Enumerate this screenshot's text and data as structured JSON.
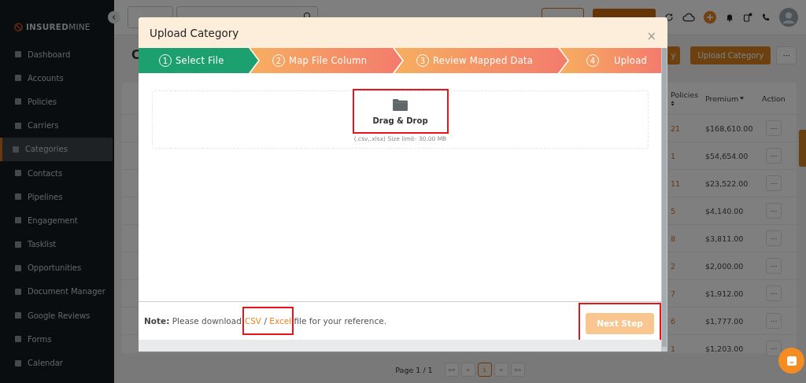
{
  "sidebar": {
    "logo": "**INSURED**MINE",
    "items": [
      {
        "label": "Dashboard",
        "selected": false
      },
      {
        "label": "Accounts",
        "selected": false
      },
      {
        "label": "Policies",
        "selected": false
      },
      {
        "label": "Carriers",
        "selected": false
      },
      {
        "label": "Categories",
        "selected": true
      },
      {
        "label": "Contacts",
        "selected": false
      },
      {
        "label": "Pipelines",
        "selected": false
      },
      {
        "label": "Engagement",
        "selected": false
      },
      {
        "label": "Tasklist",
        "selected": false
      },
      {
        "label": "Opportunities",
        "selected": false
      },
      {
        "label": "Document Manager",
        "selected": false
      },
      {
        "label": "Google Reviews",
        "selected": false
      },
      {
        "label": "Forms",
        "selected": false
      },
      {
        "label": "Calendar",
        "selected": false
      }
    ]
  },
  "page": {
    "title": "C",
    "buttons": [
      {
        "label": "y",
        "kind": "primary"
      },
      {
        "label": "Upload Category",
        "kind": "primary"
      },
      {
        "label": "···",
        "kind": "outline"
      }
    ]
  },
  "table": {
    "columns": [
      "Policies",
      "Premium",
      "Action"
    ],
    "rows": [
      {
        "policies": "21",
        "premium": "$168,610.00",
        "action": "···"
      },
      {
        "policies": "1",
        "premium": "$54,654.00",
        "action": "···"
      },
      {
        "policies": "11",
        "premium": "$23,522.00",
        "action": "···"
      },
      {
        "policies": "5",
        "premium": "$4,140.00",
        "action": "···"
      },
      {
        "policies": "8",
        "premium": "$3,811.00",
        "action": "···"
      },
      {
        "policies": "2",
        "premium": "$2,000.00",
        "action": "···"
      },
      {
        "policies": "7",
        "premium": "$1,912.00",
        "action": "···"
      },
      {
        "policies": "6",
        "premium": "$1,777.00",
        "action": "···"
      },
      {
        "policies": "1",
        "premium": "$1,203.00",
        "action": "···"
      }
    ]
  },
  "pagination": {
    "label": "Page 1 / 1",
    "buttons": [
      {
        "label": "««",
        "selected": false
      },
      {
        "label": "«",
        "selected": false
      },
      {
        "label": "1",
        "selected": true
      },
      {
        "label": "»",
        "selected": false
      },
      {
        "label": "»»",
        "selected": false
      }
    ]
  },
  "modal": {
    "title": "Upload Category",
    "close": "×",
    "steps": [
      {
        "number": "1",
        "label": "Select File",
        "selected": true
      },
      {
        "number": "2",
        "label": "Map File Column",
        "selected": false
      },
      {
        "number": "3",
        "label": "Review Mapped Data",
        "selected": false
      },
      {
        "number": "4",
        "label": "Upload",
        "selected": false
      }
    ],
    "dropzone": {
      "label": "Drag & Drop",
      "hint": "(.csv,.xlsx) Size limit- 30.00 MB"
    },
    "note": {
      "label": "Note:",
      "before": "Please download",
      "links": [
        "CSV",
        "Excel"
      ],
      "separator": "/",
      "after": "file for your reference."
    },
    "next_button": {
      "label": "Next Step",
      "disabled": true
    }
  }
}
